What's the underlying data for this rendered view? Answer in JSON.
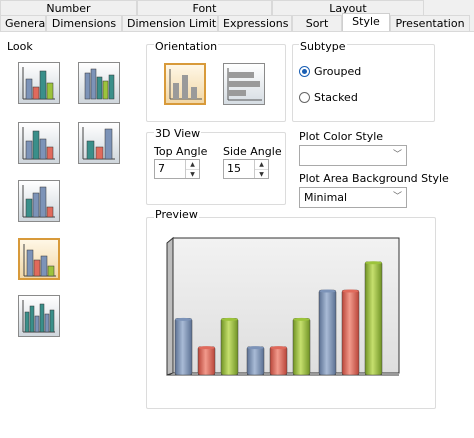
{
  "tabs_top": [
    "Number",
    "Font",
    "Layout"
  ],
  "tabs_bottom": [
    "General",
    "Dimensions",
    "Dimension Limits",
    "Expressions",
    "Sort",
    "Style",
    "Presentation"
  ],
  "active_tab": "Style",
  "look": {
    "label": "Look"
  },
  "orientation": {
    "label": "Orientation"
  },
  "subtype": {
    "label": "Subtype",
    "grouped": "Grouped",
    "stacked": "Stacked",
    "selected": "Grouped"
  },
  "view3d": {
    "label": "3D View",
    "top_angle_label": "Top Angle",
    "top_angle": "7",
    "side_angle_label": "Side Angle",
    "side_angle": "15"
  },
  "plot_color": {
    "label": "Plot Color Style",
    "value": ""
  },
  "plot_area": {
    "label": "Plot Area Background Style",
    "value": "Minimal"
  },
  "preview": {
    "label": "Preview"
  },
  "colors": {
    "blue": "#7c93b8",
    "red": "#e06a5c",
    "green": "#9cc33c",
    "teal": "#3a8f8a"
  },
  "chart_data": {
    "type": "bar",
    "series": [
      {
        "color": "blue",
        "values": [
          0.48,
          0.24,
          0.72
        ]
      },
      {
        "color": "red",
        "values": [
          0.24,
          0.24,
          0.72
        ]
      },
      {
        "color": "green",
        "values": [
          0.48,
          0.48,
          0.96
        ]
      }
    ],
    "ylim": [
      0,
      1
    ]
  }
}
